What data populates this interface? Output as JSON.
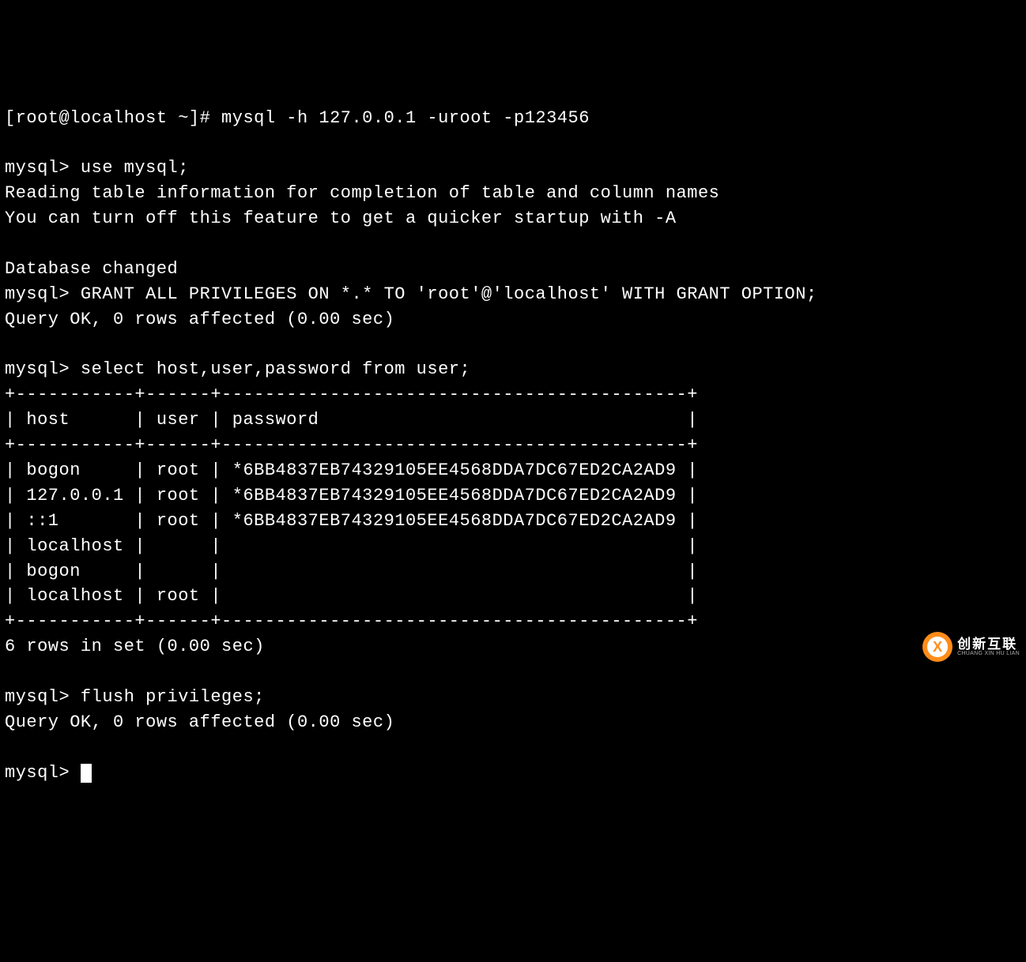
{
  "terminal": {
    "lines": [
      "[root@localhost ~]# mysql -h 127.0.0.1 -uroot -p123456",
      "",
      "mysql> use mysql;",
      "Reading table information for completion of table and column names",
      "You can turn off this feature to get a quicker startup with -A",
      "",
      "Database changed",
      "mysql> GRANT ALL PRIVILEGES ON *.* TO 'root'@'localhost' WITH GRANT OPTION;",
      "Query OK, 0 rows affected (0.00 sec)",
      "",
      "mysql> select host,user,password from user;",
      "+-----------+------+-------------------------------------------+",
      "| host      | user | password                                  |",
      "+-----------+------+-------------------------------------------+",
      "| bogon     | root | *6BB4837EB74329105EE4568DDA7DC67ED2CA2AD9 |",
      "| 127.0.0.1 | root | *6BB4837EB74329105EE4568DDA7DC67ED2CA2AD9 |",
      "| ::1       | root | *6BB4837EB74329105EE4568DDA7DC67ED2CA2AD9 |",
      "| localhost |      |                                           |",
      "| bogon     |      |                                           |",
      "| localhost | root |                                           |",
      "+-----------+------+-------------------------------------------+",
      "6 rows in set (0.00 sec)",
      "",
      "mysql> flush privileges;",
      "Query OK, 0 rows affected (0.00 sec)",
      "",
      "mysql> "
    ],
    "prompt_final": "mysql> "
  },
  "watermark": {
    "cn": "创新互联",
    "en": "CHUANG XIN HU LIAN"
  }
}
